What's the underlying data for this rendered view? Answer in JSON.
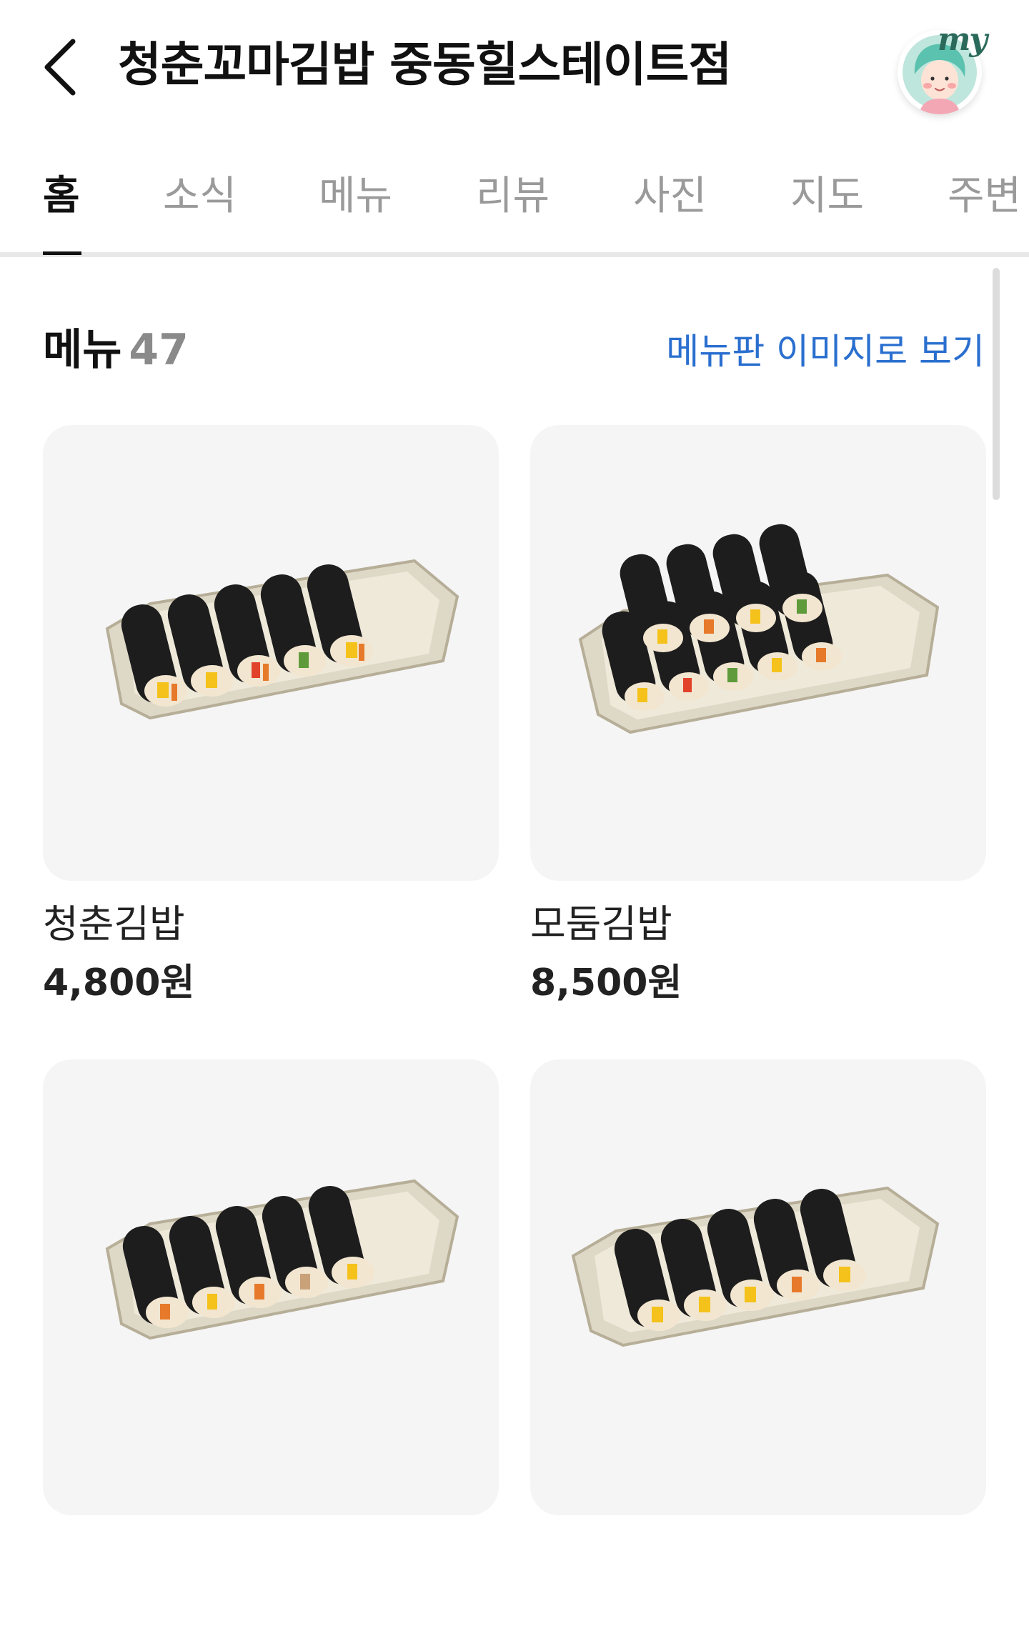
{
  "header": {
    "back_icon": "chevron-left-icon",
    "title": "청춘꼬마김밥 중동힐스테이트점",
    "my_label": "my",
    "my_icon": "user-avatar-icon"
  },
  "tabs": [
    {
      "label": "홈",
      "active": true
    },
    {
      "label": "소식",
      "active": false
    },
    {
      "label": "메뉴",
      "active": false
    },
    {
      "label": "리뷰",
      "active": false
    },
    {
      "label": "사진",
      "active": false
    },
    {
      "label": "지도",
      "active": false
    },
    {
      "label": "주변",
      "active": false
    }
  ],
  "menu_section": {
    "title": "메뉴",
    "count": "47",
    "view_board_link": "메뉴판 이미지로 보기"
  },
  "menu_items": [
    {
      "name": "청춘김밥",
      "price": "4,800원"
    },
    {
      "name": "모둠김밥",
      "price": "8,500원"
    },
    {
      "name": "",
      "price": ""
    },
    {
      "name": "",
      "price": ""
    }
  ],
  "colors": {
    "accent_link": "#2a6fcf",
    "active_tab": "#111111",
    "inactive_tab": "#9a9a9a",
    "card_bg": "#f5f5f5"
  }
}
